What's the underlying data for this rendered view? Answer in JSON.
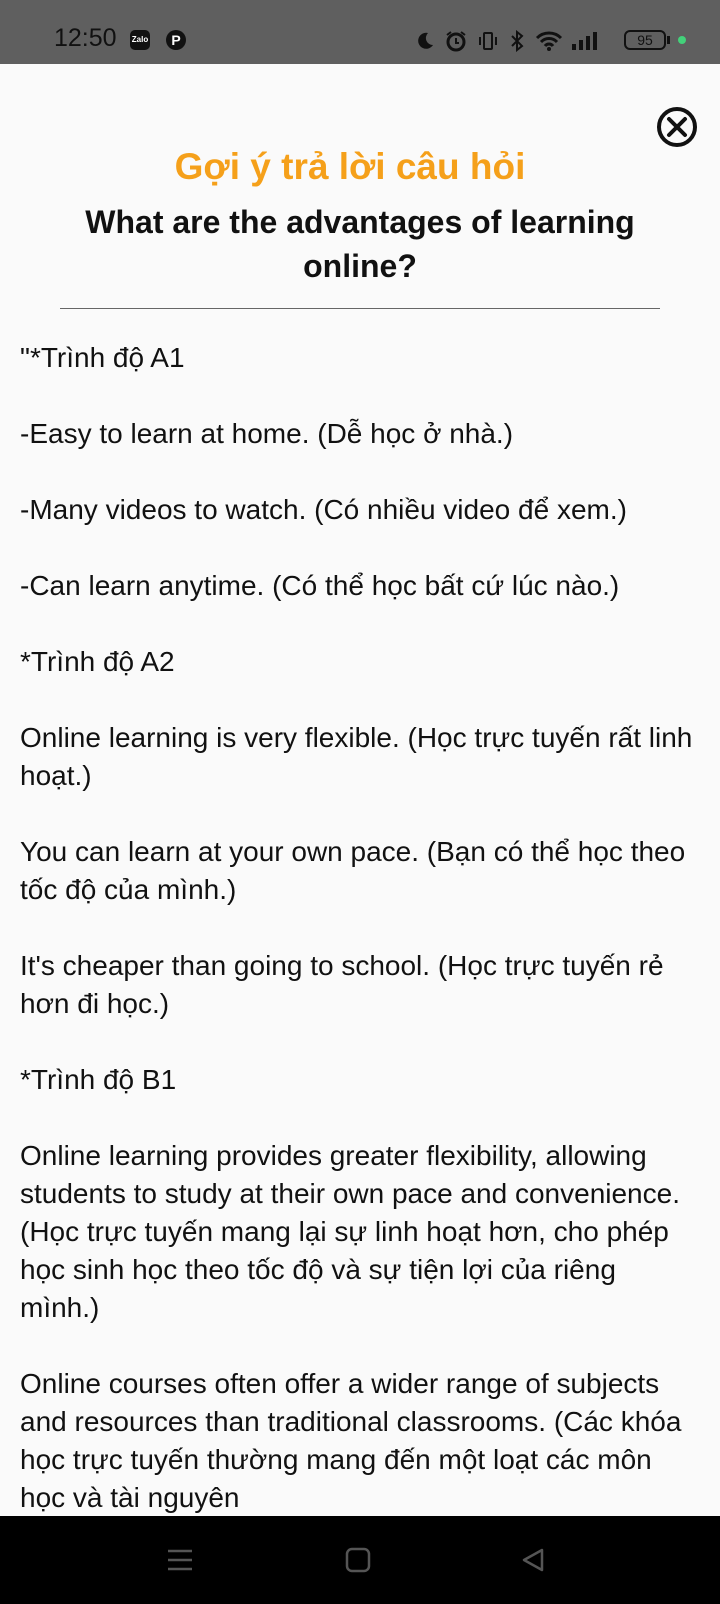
{
  "status_bar": {
    "time": "12:50",
    "apps": [
      "zalo-icon",
      "pinterest-icon"
    ],
    "zalo_label": "Zalo",
    "pinterest_label": "P",
    "icons": [
      "moon-icon",
      "alarm-icon",
      "vibrate-icon",
      "bluetooth-icon",
      "wifi-icon",
      "signal-icon"
    ],
    "battery": "95",
    "charging_color": "#43d17a"
  },
  "modal": {
    "title": "Gợi ý trả lời câu hỏi",
    "title_color": "#f5a01a",
    "question": "What are the advantages of learning online?",
    "answer_paragraphs": [
      "\"*Trình độ A1",
      "-Easy to learn at home. (Dễ học ở nhà.)",
      "-Many videos to watch. (Có nhiều video để xem.)",
      "-Can learn anytime. (Có thể học bất cứ lúc nào.)",
      "*Trình độ A2",
      "Online learning is very flexible. (Học trực tuyến rất linh hoạt.)",
      "You can learn at your own pace. (Bạn có thể học theo tốc độ của mình.)",
      "It's cheaper than going to school. (Học trực tuyến rẻ hơn đi học.)",
      "*Trình độ B1",
      "Online learning provides greater flexibility, allowing students to study at their own pace and convenience. (Học trực tuyến mang lại sự linh hoạt hơn, cho phép học sinh học theo tốc độ và sự tiện lợi của riêng mình.)",
      "Online courses often offer a wider range of subjects and resources than traditional classrooms. (Các khóa học trực tuyến thường mang đến một loạt các môn học và tài nguyên"
    ]
  },
  "nav_bar": {
    "buttons": [
      "menu-icon",
      "home-icon",
      "back-icon"
    ]
  }
}
